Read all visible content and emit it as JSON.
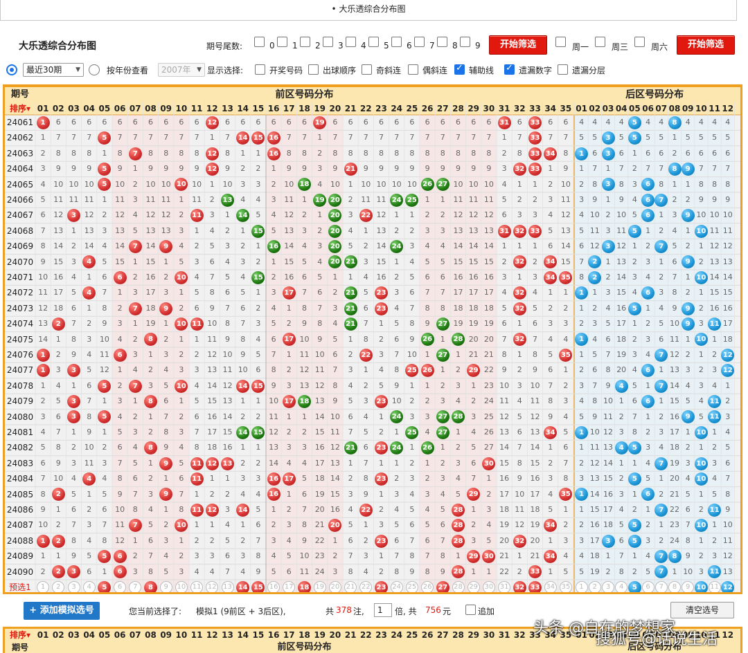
{
  "page_header": "• 大乐透综合分布图",
  "app_title": "大乐透综合分布图",
  "filter": {
    "tail_label": "期号尾数:",
    "tail_digits": [
      "0",
      "1",
      "2",
      "3",
      "4",
      "5",
      "6",
      "7",
      "8",
      "9"
    ],
    "filter_btn1": "开始筛选",
    "weekdays": [
      "周一",
      "周三",
      "周六"
    ],
    "filter_btn2": "开始筛选"
  },
  "options": {
    "recent_select": "最近30期",
    "by_year_label": "按年份查看",
    "year_select": "2007年",
    "display_label": "显示选择:",
    "checks": [
      {
        "label": "开奖号码",
        "checked": false
      },
      {
        "label": "出球顺序",
        "checked": false
      },
      {
        "label": "奇斜连",
        "checked": false
      },
      {
        "label": "偶斜连",
        "checked": false
      },
      {
        "label": "辅助线",
        "checked": true
      },
      {
        "label": "遗漏数字",
        "checked": true
      },
      {
        "label": "遗漏分层",
        "checked": false
      }
    ]
  },
  "table": {
    "period_header": "期号",
    "sort_label": "排序",
    "front_title": "前区号码分布",
    "back_title": "后区号码分布",
    "front_numbers": [
      "01",
      "02",
      "03",
      "04",
      "05",
      "06",
      "07",
      "08",
      "09",
      "10",
      "11",
      "12",
      "13",
      "14",
      "15",
      "16",
      "17",
      "18",
      "19",
      "20",
      "21",
      "22",
      "23",
      "24",
      "25",
      "26",
      "27",
      "28",
      "29",
      "30",
      "31",
      "32",
      "33",
      "34",
      "35"
    ],
    "back_numbers": [
      "01",
      "02",
      "03",
      "04",
      "05",
      "06",
      "07",
      "08",
      "09",
      "10",
      "11",
      "12"
    ],
    "rows": [
      {
        "p": "24061",
        "f": [
          1,
          12,
          19,
          31,
          33
        ],
        "b": [
          5,
          8
        ]
      },
      {
        "p": "24062",
        "f": [
          5,
          14,
          15,
          16,
          33
        ],
        "b": [
          3,
          5
        ]
      },
      {
        "p": "24063",
        "f": [
          7,
          12,
          16,
          33,
          34
        ],
        "b": [
          1,
          3
        ]
      },
      {
        "p": "24064",
        "f": [
          5,
          12,
          21,
          32,
          33
        ],
        "b": [
          8,
          9
        ]
      },
      {
        "p": "24065",
        "f": [
          5,
          10,
          18,
          26,
          27
        ],
        "b": [
          3,
          6
        ]
      },
      {
        "p": "24066",
        "f": [
          13,
          19,
          20,
          24,
          25
        ],
        "b": [
          6,
          7
        ]
      },
      {
        "p": "24067",
        "f": [
          3,
          11,
          14,
          20,
          22
        ],
        "b": [
          6,
          9
        ]
      },
      {
        "p": "24068",
        "f": [
          15,
          20,
          31,
          32,
          33
        ],
        "b": [
          5,
          10
        ]
      },
      {
        "p": "24069",
        "f": [
          7,
          9,
          16,
          20,
          24
        ],
        "b": [
          3,
          7
        ]
      },
      {
        "p": "24070",
        "f": [
          4,
          20,
          21,
          32,
          34
        ],
        "b": [
          2,
          9
        ]
      },
      {
        "p": "24071",
        "f": [
          6,
          10,
          15,
          34,
          35
        ],
        "b": [
          2,
          10
        ]
      },
      {
        "p": "24072",
        "f": [
          4,
          17,
          21,
          23,
          32
        ],
        "b": [
          1,
          6
        ]
      },
      {
        "p": "24073",
        "f": [
          7,
          9,
          21,
          23,
          32
        ],
        "b": [
          5,
          9
        ]
      },
      {
        "p": "24074",
        "f": [
          2,
          10,
          11,
          21,
          27
        ],
        "b": [
          9,
          11
        ]
      },
      {
        "p": "24075",
        "f": [
          8,
          17,
          26,
          28,
          32
        ],
        "b": [
          1,
          10
        ]
      },
      {
        "p": "24076",
        "f": [
          1,
          6,
          22,
          27,
          35
        ],
        "b": [
          7,
          12
        ]
      },
      {
        "p": "24077",
        "f": [
          1,
          3,
          25,
          26,
          29
        ],
        "b": [
          6,
          12
        ]
      },
      {
        "p": "24078",
        "f": [
          5,
          7,
          10,
          14,
          15
        ],
        "b": [
          4,
          7
        ]
      },
      {
        "p": "24079",
        "f": [
          3,
          8,
          17,
          18,
          23
        ],
        "b": [
          6,
          11
        ]
      },
      {
        "p": "24080",
        "f": [
          3,
          5,
          24,
          27,
          28
        ],
        "b": [
          9,
          11
        ]
      },
      {
        "p": "24081",
        "f": [
          14,
          15,
          25,
          27,
          34
        ],
        "b": [
          1,
          10
        ]
      },
      {
        "p": "24082",
        "f": [
          8,
          21,
          23,
          24,
          26
        ],
        "b": [
          4,
          5
        ]
      },
      {
        "p": "24083",
        "f": [
          9,
          11,
          12,
          13,
          30
        ],
        "b": [
          7,
          10
        ]
      },
      {
        "p": "24084",
        "f": [
          4,
          11,
          16,
          17,
          23
        ],
        "b": [
          5,
          10
        ]
      },
      {
        "p": "24085",
        "f": [
          2,
          9,
          16,
          29,
          35
        ],
        "b": [
          1,
          6
        ]
      },
      {
        "p": "24086",
        "f": [
          11,
          12,
          14,
          22,
          28
        ],
        "b": [
          7,
          11
        ]
      },
      {
        "p": "24087",
        "f": [
          7,
          10,
          20,
          28,
          34
        ],
        "b": [
          5,
          10
        ]
      },
      {
        "p": "24088",
        "f": [
          1,
          2,
          23,
          28,
          32
        ],
        "b": [
          3,
          5
        ]
      },
      {
        "p": "24089",
        "f": [
          5,
          6,
          29,
          30,
          34
        ],
        "b": [
          7,
          8
        ]
      },
      {
        "p": "24090",
        "f": [
          2,
          3,
          6,
          28,
          33
        ],
        "b": [
          7,
          11
        ]
      }
    ],
    "preselect_label": "预选1",
    "preselect_front": [
      5,
      8,
      14,
      15,
      18,
      23,
      27,
      32,
      33
    ],
    "preselect_back": [
      5,
      10,
      12
    ]
  },
  "bottom": {
    "add_button": "+ 添加模拟选号",
    "current_label": "您当前选择了:",
    "sim_text": "模拟1 (9前区 + 3后区),",
    "total_label": "共",
    "total_count": "378",
    "total_unit": "注,",
    "multiple": "1",
    "multiple_unit": "倍, 共",
    "amount": "756",
    "amount_unit": "元",
    "append_label": "追加",
    "clear_button": "清空选号"
  },
  "watermark": "头条 @自在的梦想家",
  "watermark2": "搜狐号@话说生活"
}
